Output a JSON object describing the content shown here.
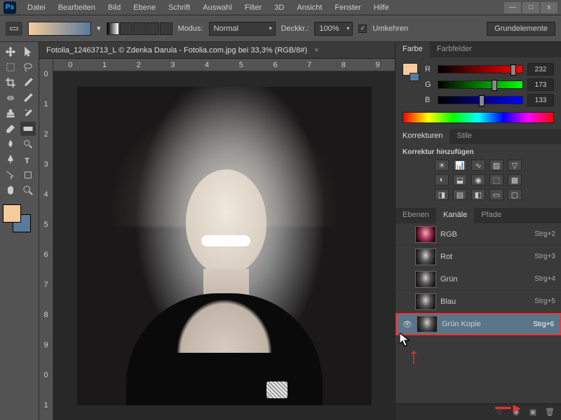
{
  "app": {
    "icon_text": "Ps"
  },
  "menu": [
    "Datei",
    "Bearbeiten",
    "Bild",
    "Ebene",
    "Schrift",
    "Auswahl",
    "Filter",
    "3D",
    "Ansicht",
    "Fenster",
    "Hilfe"
  ],
  "optbar": {
    "modus_label": "Modus:",
    "modus_value": "Normal",
    "deckkr_label": "Deckkr.:",
    "deckkr_value": "100%",
    "umkehren": "Umkehren",
    "grundelemente": "Grundelemente"
  },
  "doc": {
    "title": "Fotolia_12463713_L © Zdenka Darula - Fotolia.com.jpg bei 33,3% (RGB/8#)"
  },
  "rulers": {
    "h": [
      "0",
      "1",
      "2",
      "3",
      "4",
      "5",
      "6",
      "7",
      "8",
      "9"
    ],
    "v": [
      "0",
      "1",
      "2",
      "3",
      "4",
      "5",
      "6",
      "7",
      "8",
      "9",
      "0",
      "1"
    ]
  },
  "panels": {
    "color": {
      "tab_farbe": "Farbe",
      "tab_farbfelder": "Farbfelder",
      "r_label": "R",
      "g_label": "G",
      "b_label": "B",
      "r_val": "232",
      "g_val": "173",
      "b_val": "133"
    },
    "adjust": {
      "tab_korrekturen": "Korrekturen",
      "tab_stile": "Stile",
      "add_label": "Korrektur hinzufügen"
    },
    "channels": {
      "tab_ebenen": "Ebenen",
      "tab_kanale": "Kanäle",
      "tab_pfade": "Pfade",
      "items": [
        {
          "name": "RGB",
          "shortcut": "Strg+2"
        },
        {
          "name": "Rot",
          "shortcut": "Strg+3"
        },
        {
          "name": "Grün",
          "shortcut": "Strg+4"
        },
        {
          "name": "Blau",
          "shortcut": "Strg+5"
        },
        {
          "name": "Grün Kopie",
          "shortcut": "Strg+6"
        }
      ]
    }
  },
  "colors": {
    "fg": "#f5cb9c",
    "bg": "#5a7a9c",
    "accent": "#e33"
  }
}
